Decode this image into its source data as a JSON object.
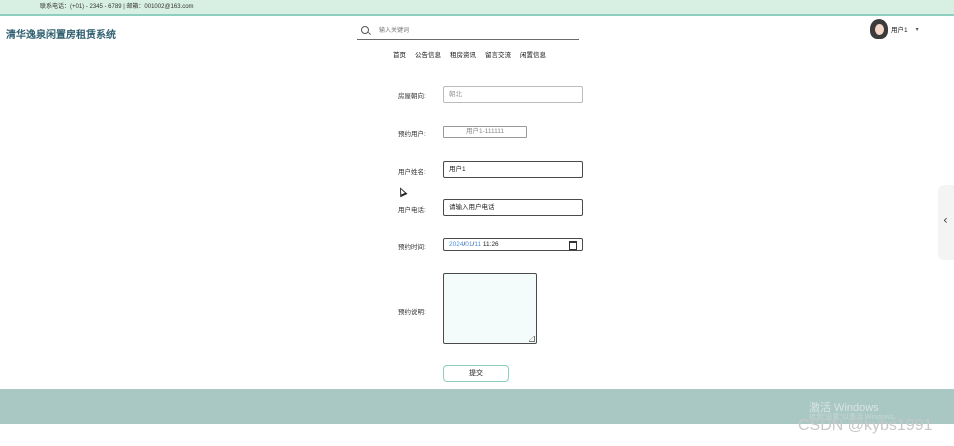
{
  "topbar": {
    "contact": "联系电话：(+01) - 2345 - 6789 | 邮箱：001002@163.com"
  },
  "site_title": "清华逸泉闲置房租赁系统",
  "search": {
    "placeholder": "输入关键词"
  },
  "user": {
    "name": "用户1",
    "caret": "▾"
  },
  "nav": {
    "items": [
      "首页",
      "公告信息",
      "租房资讯",
      "留言交流",
      "闲置信息"
    ]
  },
  "form": {
    "fields": [
      {
        "label": "房屋朝向:",
        "value": "朝北"
      },
      {
        "label": "预约用户:",
        "value": "用户1-111111"
      },
      {
        "label": "用户姓名:",
        "value": "用户1"
      },
      {
        "label": "用户电话:",
        "value": "请输入用户电话"
      },
      {
        "label": "预约时间:",
        "date_year": "2024",
        "date_sep1": "/",
        "date_month": "01",
        "date_sep2": "/",
        "date_day": "11",
        "date_time": " 11:26"
      },
      {
        "label": "预约说明:",
        "value": ""
      }
    ],
    "submit_label": "提交"
  },
  "side_tab": {
    "chevron": "‹"
  },
  "watermark": {
    "line1": "激活 Windows",
    "line2": "转到\"设置\"以激活 Windows。"
  },
  "csdn": "CSDN @kybs1991"
}
